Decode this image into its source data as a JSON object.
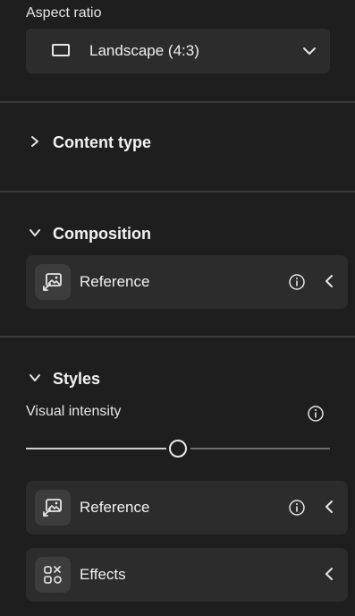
{
  "aspect_ratio": {
    "label": "Aspect ratio",
    "selected": "Landscape (4:3)",
    "icon": "landscape-rect-icon"
  },
  "sections": {
    "content_type": {
      "title": "Content type",
      "expanded": false
    },
    "composition": {
      "title": "Composition",
      "expanded": true,
      "reference": {
        "label": "Reference",
        "icon": "image-reference-icon"
      }
    },
    "styles": {
      "title": "Styles",
      "expanded": true,
      "visual_intensity": {
        "label": "Visual intensity",
        "value": 0.5
      },
      "reference": {
        "label": "Reference",
        "icon": "image-reference-icon"
      },
      "effects": {
        "label": "Effects",
        "icon": "effects-icon"
      }
    }
  }
}
